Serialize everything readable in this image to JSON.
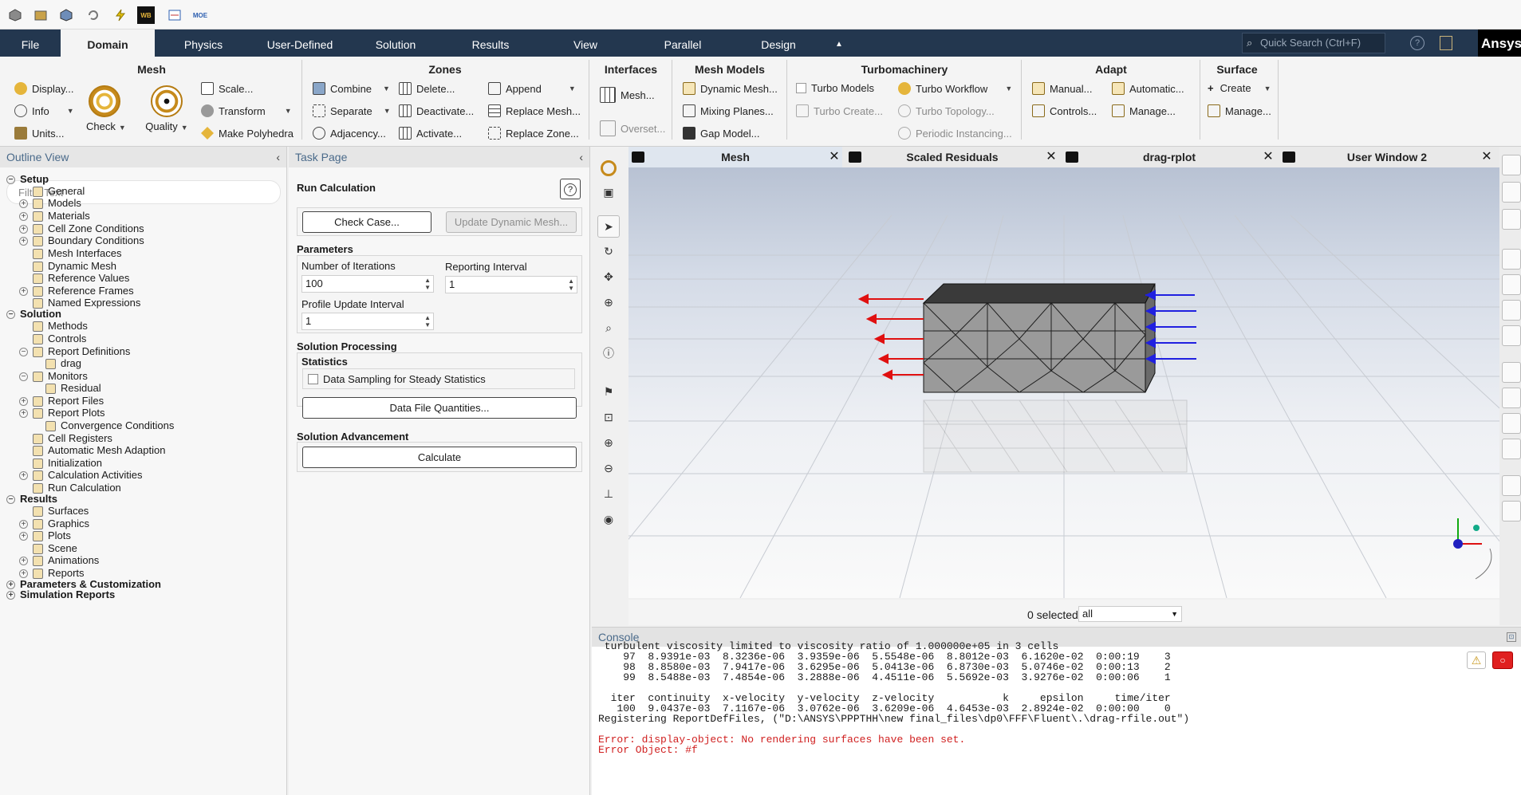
{
  "qat": {
    "wb_label": "WB",
    "moe_label": "MOE"
  },
  "menubar": {
    "items": [
      "File",
      "Domain",
      "Physics",
      "User-Defined",
      "Solution",
      "Results",
      "View",
      "Parallel",
      "Design"
    ],
    "active": "Domain",
    "search_placeholder": "Quick Search (Ctrl+F)",
    "brand": "Ansys"
  },
  "ribbon": {
    "mesh": {
      "title": "Mesh",
      "display": "Display...",
      "info": "Info",
      "units": "Units...",
      "check": "Check",
      "quality": "Quality",
      "scale": "Scale...",
      "transform": "Transform",
      "make_polyhedra": "Make Polyhedra"
    },
    "zones": {
      "title": "Zones",
      "combine": "Combine",
      "separate": "Separate",
      "adjacency": "Adjacency...",
      "delete": "Delete...",
      "deactivate": "Deactivate...",
      "activate": "Activate...",
      "append": "Append",
      "replace_mesh": "Replace Mesh...",
      "replace_zone": "Replace Zone..."
    },
    "interfaces": {
      "title": "Interfaces",
      "mesh": "Mesh...",
      "overset": "Overset..."
    },
    "mesh_models": {
      "title": "Mesh Models",
      "dynamic_mesh": "Dynamic Mesh...",
      "mixing_planes": "Mixing Planes...",
      "gap_model": "Gap Model..."
    },
    "turbomachinery": {
      "title": "Turbomachinery",
      "turbo_models": "Turbo Models",
      "turbo_create": "Turbo Create...",
      "turbo_workflow": "Turbo Workflow",
      "turbo_topology": "Turbo Topology...",
      "periodic_instancing": "Periodic Instancing..."
    },
    "adapt": {
      "title": "Adapt",
      "manual": "Manual...",
      "controls": "Controls...",
      "automatic": "Automatic...",
      "manage": "Manage..."
    },
    "surface": {
      "title": "Surface",
      "create": "Create",
      "manage": "Manage..."
    }
  },
  "outline": {
    "title": "Outline View",
    "filter_placeholder": "Filter Text",
    "rows": [
      "Setup",
      "General",
      "Models",
      "Materials",
      "Cell Zone Conditions",
      "Boundary Conditions",
      "Mesh Interfaces",
      "Dynamic Mesh",
      "Reference Values",
      "Reference Frames",
      "Named Expressions",
      "Solution",
      "Methods",
      "Controls",
      "Report Definitions",
      "drag",
      "Monitors",
      "Residual",
      "Report Files",
      "Report Plots",
      "Convergence Conditions",
      "Cell Registers",
      "Automatic Mesh Adaption",
      "Initialization",
      "Calculation Activities",
      "Run Calculation",
      "Results",
      "Surfaces",
      "Graphics",
      "Plots",
      "Scene",
      "Animations",
      "Reports",
      "Parameters & Customization",
      "Simulation Reports"
    ]
  },
  "taskpage": {
    "title": "Task Page",
    "heading": "Run Calculation",
    "check_case": "Check Case...",
    "update_dynamic_mesh": "Update Dynamic Mesh...",
    "parameters": "Parameters",
    "num_iter_label": "Number of Iterations",
    "num_iter_value": "100",
    "reporting_interval_label": "Reporting Interval",
    "reporting_interval_value": "1",
    "profile_update_label": "Profile Update Interval",
    "profile_update_value": "1",
    "solution_processing": "Solution Processing",
    "statistics": "Statistics",
    "data_sampling": "Data Sampling for Steady Statistics",
    "data_file_quantities": "Data File Quantities...",
    "solution_advancement": "Solution Advancement",
    "calculate": "Calculate"
  },
  "graphics": {
    "tabs": [
      "Mesh",
      "Scaled Residuals",
      "drag-rplot",
      "User Window 2"
    ],
    "active_tab": "Mesh",
    "selected_text": "0 selected",
    "selection_filter": "all"
  },
  "console": {
    "title": "Console",
    "lines": [
      " turbulent viscosity limited to viscosity ratio of 1.000000e+05 in 3 cells",
      "    97  8.9391e-03  8.3236e-06  3.9359e-06  5.5548e-06  8.8012e-03  6.1620e-02  0:00:19    3",
      "    98  8.8580e-03  7.9417e-06  3.6295e-06  5.0413e-06  6.8730e-03  5.0746e-02  0:00:13    2",
      "    99  8.5488e-03  7.4854e-06  3.2888e-06  4.4511e-06  5.5692e-03  3.9276e-02  0:00:06    1",
      "",
      "  iter  continuity  x-velocity  y-velocity  z-velocity           k     epsilon     time/iter",
      "   100  9.0437e-03  7.1167e-06  3.0762e-06  3.6209e-06  4.6453e-03  2.8924e-02  0:00:00    0",
      "Registering ReportDefFiles, (\"D:\\ANSYS\\PPPTHH\\new final_files\\dp0\\FFF\\Fluent\\.\\drag-rfile.out\")",
      ""
    ],
    "errors": [
      "Error: display-object: No rendering surfaces have been set.",
      "Error Object: #f"
    ]
  }
}
